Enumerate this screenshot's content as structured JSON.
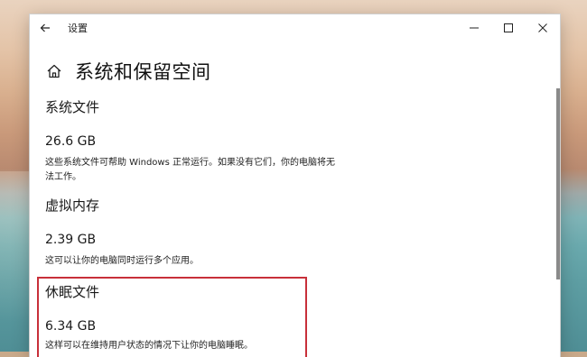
{
  "window": {
    "app_title": "设置",
    "controls": {
      "minimize": "—",
      "maximize": "☐",
      "close": "✕"
    }
  },
  "page": {
    "title": "系统和保留空间"
  },
  "sections": [
    {
      "title": "系统文件",
      "size": "26.6 GB",
      "desc_lines": [
        "这些系统文件可帮助 Windows 正常运行。如果没有它们，你的电脑将无",
        "法工作。"
      ]
    },
    {
      "title": "虚拟内存",
      "size": "2.39 GB",
      "desc_lines": [
        "这可以让你的电脑同时运行多个应用。"
      ]
    },
    {
      "title": "休眠文件",
      "size": "6.34 GB",
      "desc_lines": [
        "这样可以在维持用户状态的情况下让你的电脑睡眠。"
      ]
    }
  ],
  "colors": {
    "highlight_border": "#c8303a",
    "window_bg": "#ffffff",
    "text": "#1a1a1a"
  },
  "icons": [
    "back-arrow-icon",
    "home-icon",
    "minimize-icon",
    "maximize-icon",
    "close-icon"
  ]
}
